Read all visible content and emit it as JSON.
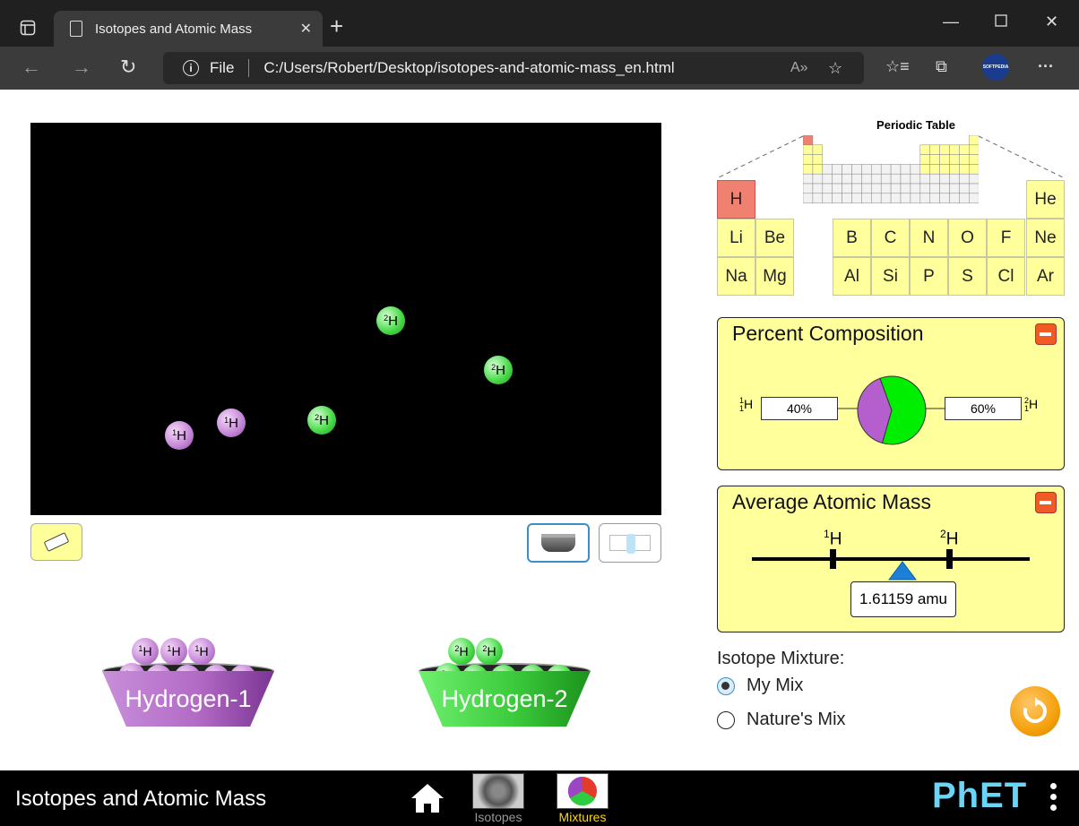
{
  "browser": {
    "tab_title": "Isotopes and Atomic Mass",
    "address_file": "File",
    "address_url": "C:/Users/Robert/Desktop/isotopes-and-atomic-mass_en.html",
    "profile_badge": "SOFTPEDIA"
  },
  "test_chamber": {
    "atoms": [
      {
        "mass": "2",
        "symbol": "H",
        "isotope": "hydrogen-2"
      },
      {
        "mass": "2",
        "symbol": "H",
        "isotope": "hydrogen-2"
      },
      {
        "mass": "1",
        "symbol": "H",
        "isotope": "hydrogen-1"
      },
      {
        "mass": "1",
        "symbol": "H",
        "isotope": "hydrogen-1"
      },
      {
        "mass": "2",
        "symbol": "H",
        "isotope": "hydrogen-2"
      }
    ]
  },
  "buckets": [
    {
      "label": "Hydrogen-1",
      "atom_mass": "1",
      "atom_symbol": "H"
    },
    {
      "label": "Hydrogen-2",
      "atom_mass": "2",
      "atom_symbol": "H"
    }
  ],
  "periodic_table": {
    "title": "Periodic Table",
    "selected": "H",
    "elements": [
      "H",
      "He",
      "Li",
      "Be",
      "B",
      "C",
      "N",
      "O",
      "F",
      "Ne",
      "Na",
      "Mg",
      "Al",
      "Si",
      "P",
      "S",
      "Cl",
      "Ar"
    ]
  },
  "percent_composition": {
    "title": "Percent Composition",
    "left_isotope": {
      "mass": "1",
      "atomic": "1",
      "symbol": "H",
      "percent": "40%"
    },
    "right_isotope": {
      "mass": "2",
      "atomic": "1",
      "symbol": "H",
      "percent": "60%"
    },
    "colors": {
      "hydrogen-1": "#b55fcf",
      "hydrogen-2": "#00ee00"
    }
  },
  "average_atomic_mass": {
    "title": "Average Atomic Mass",
    "tick_left": {
      "mass": "1",
      "symbol": "H"
    },
    "tick_right": {
      "mass": "2",
      "symbol": "H"
    },
    "readout": "1.61159 amu"
  },
  "isotope_mixture": {
    "label": "Isotope Mixture:",
    "options": [
      "My Mix",
      "Nature's Mix"
    ],
    "selected": "My Mix"
  },
  "navbar": {
    "title": "Isotopes and Atomic Mass",
    "screens": [
      {
        "label": "Isotopes",
        "selected": false
      },
      {
        "label": "Mixtures",
        "selected": true
      }
    ],
    "brand": "PhET",
    "selected_color": "#ffd700"
  }
}
